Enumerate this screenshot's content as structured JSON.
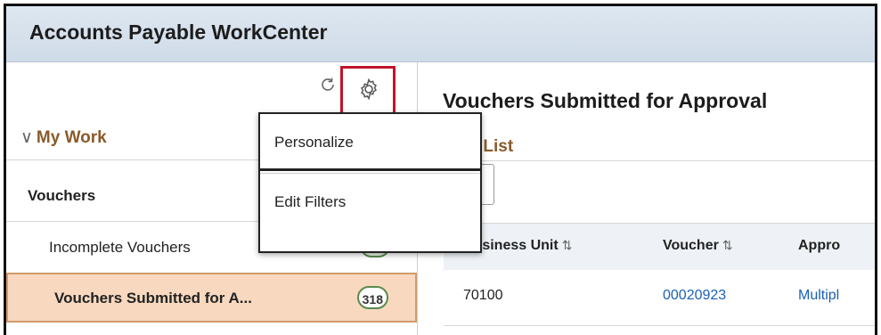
{
  "header": {
    "title": "Accounts Payable WorkCenter"
  },
  "left_panel": {
    "icons": [
      "refresh-icon",
      "gear-icon"
    ],
    "my_work_label": "My Work",
    "section_title": "Vouchers",
    "items": [
      {
        "label": "Incomplete Vouchers",
        "count": ""
      },
      {
        "label": "Vouchers Submitted for A...",
        "count": "318",
        "selected": true
      }
    ]
  },
  "context_menu": {
    "items": [
      {
        "label": "Personalize"
      },
      {
        "label": "Edit Filters"
      }
    ]
  },
  "main": {
    "title": "Vouchers Submitted for Approval",
    "subtitle": "cher List",
    "table": {
      "columns": [
        {
          "label": "Business Unit",
          "sort_icon": "⇅"
        },
        {
          "label": "Voucher",
          "sort_icon": "⇅"
        },
        {
          "label": "Appro"
        }
      ],
      "rows": [
        {
          "business_unit": "70100",
          "voucher": "00020923",
          "approver": "Multipl"
        }
      ]
    }
  },
  "colors": {
    "highlight": "#c0142b",
    "accent": "#8a5a2a",
    "link": "#1a5fb4",
    "selected_bg": "#f8d9bf"
  }
}
